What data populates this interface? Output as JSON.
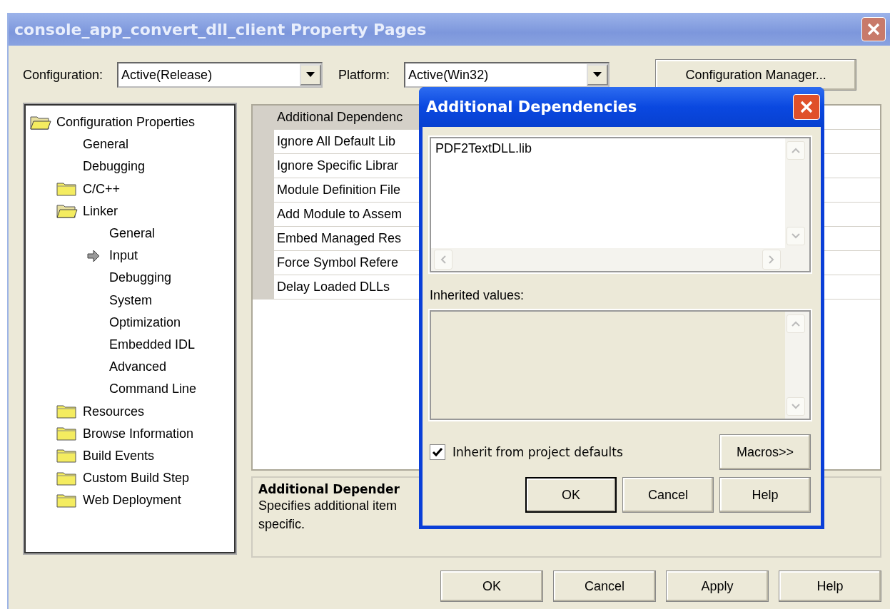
{
  "window": {
    "title": "console_app_convert_dll_client Property Pages"
  },
  "configuration": {
    "label": "Configuration:",
    "value": "Active(Release)"
  },
  "platform": {
    "label": "Platform:",
    "value": "Active(Win32)"
  },
  "configuration_manager_button": "Configuration Manager...",
  "tree": [
    {
      "label": "Configuration Properties",
      "expanded": true,
      "selected": false,
      "children": [
        {
          "label": "General",
          "selected": false
        },
        {
          "label": "Debugging",
          "selected": false
        },
        {
          "label": "C/C++",
          "expanded": false,
          "selected": false
        },
        {
          "label": "Linker",
          "expanded": true,
          "selected": false,
          "children": [
            {
              "label": "General",
              "selected": false
            },
            {
              "label": "Input",
              "selected": true
            },
            {
              "label": "Debugging",
              "selected": false
            },
            {
              "label": "System",
              "selected": false
            },
            {
              "label": "Optimization",
              "selected": false
            },
            {
              "label": "Embedded IDL",
              "selected": false
            },
            {
              "label": "Advanced",
              "selected": false
            },
            {
              "label": "Command Line",
              "selected": false
            }
          ]
        },
        {
          "label": "Resources",
          "expanded": false,
          "selected": false
        },
        {
          "label": "Browse Information",
          "expanded": false,
          "selected": false
        },
        {
          "label": "Build Events",
          "expanded": false,
          "selected": false
        },
        {
          "label": "Custom Build Step",
          "expanded": false,
          "selected": false
        },
        {
          "label": "Web Deployment",
          "expanded": false,
          "selected": false
        }
      ]
    }
  ],
  "properties": [
    {
      "name": "Additional Dependenc",
      "selected": true
    },
    {
      "name": "Ignore All Default Lib",
      "selected": false
    },
    {
      "name": "Ignore Specific Librar",
      "selected": false
    },
    {
      "name": "Module Definition File",
      "selected": false
    },
    {
      "name": "Add Module to Assem",
      "selected": false
    },
    {
      "name": "Embed Managed Res",
      "selected": false
    },
    {
      "name": "Force Symbol Refere",
      "selected": false
    },
    {
      "name": "Delay Loaded DLLs",
      "selected": false
    }
  ],
  "description": {
    "title": "Additional Depender",
    "text": "Specifies additional item\nspecific."
  },
  "buttons": [
    "OK",
    "Cancel",
    "Apply",
    "Help"
  ],
  "dialog": {
    "title": "Additional Dependencies",
    "value": "PDF2TextDLL.lib",
    "inherited_label": "Inherited values:",
    "inherit_checkbox": {
      "label": "Inherit from project defaults",
      "checked": true
    },
    "macros_button": "Macros>>",
    "buttons": [
      "OK",
      "Cancel",
      "Help"
    ]
  }
}
